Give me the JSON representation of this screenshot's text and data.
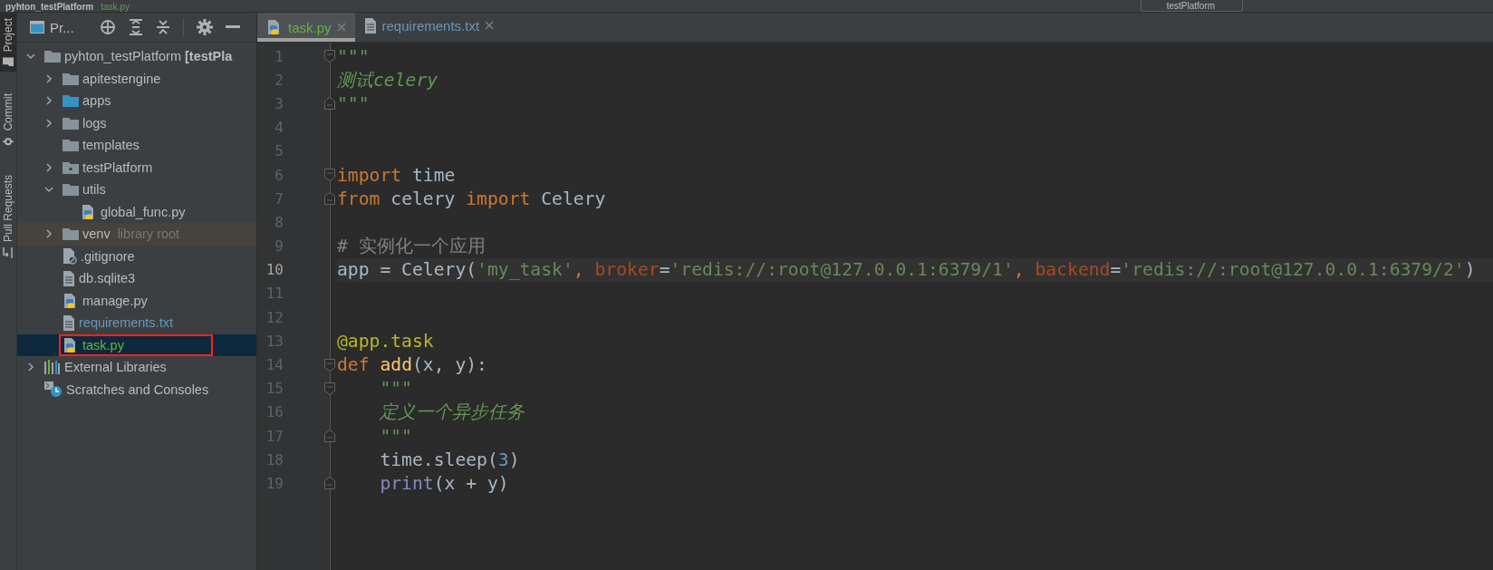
{
  "title_bar": {
    "project": "pyhton_testPlatform",
    "file": "task.py",
    "run_config": "testPlatform"
  },
  "side_tabs": [
    {
      "label": "Project",
      "kind": "folder",
      "selected": true
    },
    {
      "label": "Commit",
      "kind": "commit",
      "selected": false
    },
    {
      "label": "Pull Requests",
      "kind": "pull",
      "selected": false
    }
  ],
  "project_panel": {
    "title": "Pr...",
    "tree": [
      {
        "label": "pyhton_testPlatform **[testPla**",
        "kind": "folder",
        "expanded": true,
        "selected": false,
        "color": "#bbbbbb",
        "children": [
          {
            "label": "apitestengine",
            "kind": "folder",
            "expanded": false,
            "selected": false,
            "color": "#bbbbbb"
          },
          {
            "label": "apps",
            "kind": "folder-blue",
            "expanded": false,
            "selected": false,
            "color": "#bbbbbb"
          },
          {
            "label": "logs",
            "kind": "folder",
            "expanded": false,
            "selected": false,
            "color": "#bbbbbb"
          },
          {
            "label": "templates",
            "kind": "folder",
            "selected": false,
            "color": "#bbbbbb"
          },
          {
            "label": "testPlatform",
            "kind": "folder-package",
            "expanded": false,
            "selected": false,
            "color": "#bbbbbb"
          },
          {
            "label": "utils",
            "kind": "folder",
            "expanded": true,
            "selected": false,
            "color": "#bbbbbb",
            "children": [
              {
                "label": "global_func.py",
                "kind": "python",
                "selected": false,
                "color": "#bbbbbb"
              }
            ]
          },
          {
            "label": "venv",
            "note": "library root",
            "kind": "folder",
            "expanded": false,
            "selected": false,
            "shaded": true,
            "color": "#bbbbbb"
          },
          {
            "label": ".gitignore",
            "kind": "ignore",
            "selected": false,
            "color": "#bbbbbb"
          },
          {
            "label": "db.sqlite3",
            "kind": "text",
            "selected": false,
            "color": "#bbbbbb"
          },
          {
            "label": "manage.py",
            "kind": "python",
            "selected": false,
            "color": "#bbbbbb"
          },
          {
            "label": "requirements.txt",
            "kind": "text",
            "selected": false,
            "color": "#6897bb"
          },
          {
            "label": "task.py",
            "kind": "python",
            "selected": true,
            "color": "#62b543",
            "boxed": true
          }
        ]
      },
      {
        "label": "External Libraries",
        "kind": "libraries",
        "expanded": false,
        "selected": false,
        "color": "#bbbbbb"
      },
      {
        "label": "Scratches and Consoles",
        "kind": "scratches",
        "selected": false,
        "color": "#bbbbbb"
      }
    ]
  },
  "editor": {
    "tabs": [
      {
        "label": "task.py",
        "kind": "python",
        "color": "#62b543",
        "selected": true
      },
      {
        "label": "requirements.txt",
        "kind": "text",
        "color": "#6897bb",
        "selected": false
      }
    ],
    "lines": [
      {
        "number": "1",
        "current": false,
        "indented": false,
        "kind": "fold-start",
        "tokens": [
          {
            "kind": "doc",
            "text": "\"\"\""
          }
        ]
      },
      {
        "number": "2",
        "current": false,
        "indented": false,
        "kind": "plain",
        "tokens": [
          {
            "kind": "doc",
            "text": "测试celery"
          }
        ]
      },
      {
        "number": "3",
        "current": false,
        "indented": false,
        "kind": "fold-end",
        "tokens": [
          {
            "kind": "doc",
            "text": "\"\"\""
          }
        ]
      },
      {
        "number": "4",
        "current": false,
        "kind": "plain"
      },
      {
        "number": "5",
        "current": false,
        "kind": "plain"
      },
      {
        "number": "6",
        "current": false,
        "indented": false,
        "kind": "fold-start",
        "tokens": [
          {
            "kind": "kw",
            "text": "import"
          },
          {
            "kind": "plain",
            "text": " time"
          }
        ]
      },
      {
        "number": "7",
        "current": false,
        "indented": false,
        "kind": "fold-end",
        "tokens": [
          {
            "kind": "kw",
            "text": "from"
          },
          {
            "kind": "plain",
            "text": " celery "
          },
          {
            "kind": "kw",
            "text": "import"
          },
          {
            "kind": "plain",
            "text": " Celery"
          }
        ]
      },
      {
        "number": "8",
        "current": false,
        "kind": "plain"
      },
      {
        "number": "9",
        "current": false,
        "indented": false,
        "kind": "plain",
        "tokens": [
          {
            "kind": "comment",
            "text": "# 实例化一个应用"
          }
        ]
      },
      {
        "number": "10",
        "current": true,
        "indented": false,
        "kind": "plain",
        "tokens": [
          {
            "kind": "plain",
            "text": "app = Celery("
          },
          {
            "kind": "str",
            "text": "'my_task'"
          },
          {
            "kind": "kw",
            "text": ", "
          },
          {
            "kind": "kwarg",
            "text": "broker"
          },
          {
            "kind": "plain",
            "text": "="
          },
          {
            "kind": "str",
            "text": "'redis://:root@127.0.0.1:6379/1'"
          },
          {
            "kind": "kw",
            "text": ", "
          },
          {
            "kind": "kwarg",
            "text": "backend"
          },
          {
            "kind": "plain",
            "text": "="
          },
          {
            "kind": "str",
            "text": "'redis://:root@127.0.0.1:6379/2'"
          },
          {
            "kind": "plain",
            "text": ")"
          }
        ]
      },
      {
        "number": "11",
        "current": false,
        "kind": "plain"
      },
      {
        "number": "12",
        "current": false,
        "kind": "plain"
      },
      {
        "number": "13",
        "current": false,
        "indented": false,
        "kind": "plain",
        "tokens": [
          {
            "kind": "deco",
            "text": "@app.task"
          }
        ]
      },
      {
        "number": "14",
        "current": false,
        "indented": false,
        "kind": "fold-start",
        "tokens": [
          {
            "kind": "kw",
            "text": "def "
          },
          {
            "kind": "fn",
            "text": "add"
          },
          {
            "kind": "plain",
            "text": "(x, y):"
          }
        ]
      },
      {
        "number": "15",
        "current": false,
        "indented": true,
        "kind": "fold-start",
        "tokens": [
          {
            "kind": "doc",
            "text": "\"\"\""
          }
        ]
      },
      {
        "number": "16",
        "current": false,
        "indented": true,
        "kind": "plain",
        "tokens": [
          {
            "kind": "doc",
            "text": "定义一个异步任务"
          }
        ]
      },
      {
        "number": "17",
        "current": false,
        "indented": true,
        "kind": "fold-end",
        "tokens": [
          {
            "kind": "doc",
            "text": "\"\"\""
          }
        ]
      },
      {
        "number": "18",
        "current": false,
        "indented": true,
        "kind": "plain",
        "tokens": [
          {
            "kind": "plain",
            "text": "time.sleep("
          },
          {
            "kind": "num",
            "text": "3"
          },
          {
            "kind": "plain",
            "text": ")"
          }
        ]
      },
      {
        "number": "19",
        "current": false,
        "indented": true,
        "kind": "fold-end",
        "tokens": [
          {
            "kind": "builtin",
            "text": "print"
          },
          {
            "kind": "plain",
            "text": "(x + y)"
          }
        ]
      }
    ]
  }
}
